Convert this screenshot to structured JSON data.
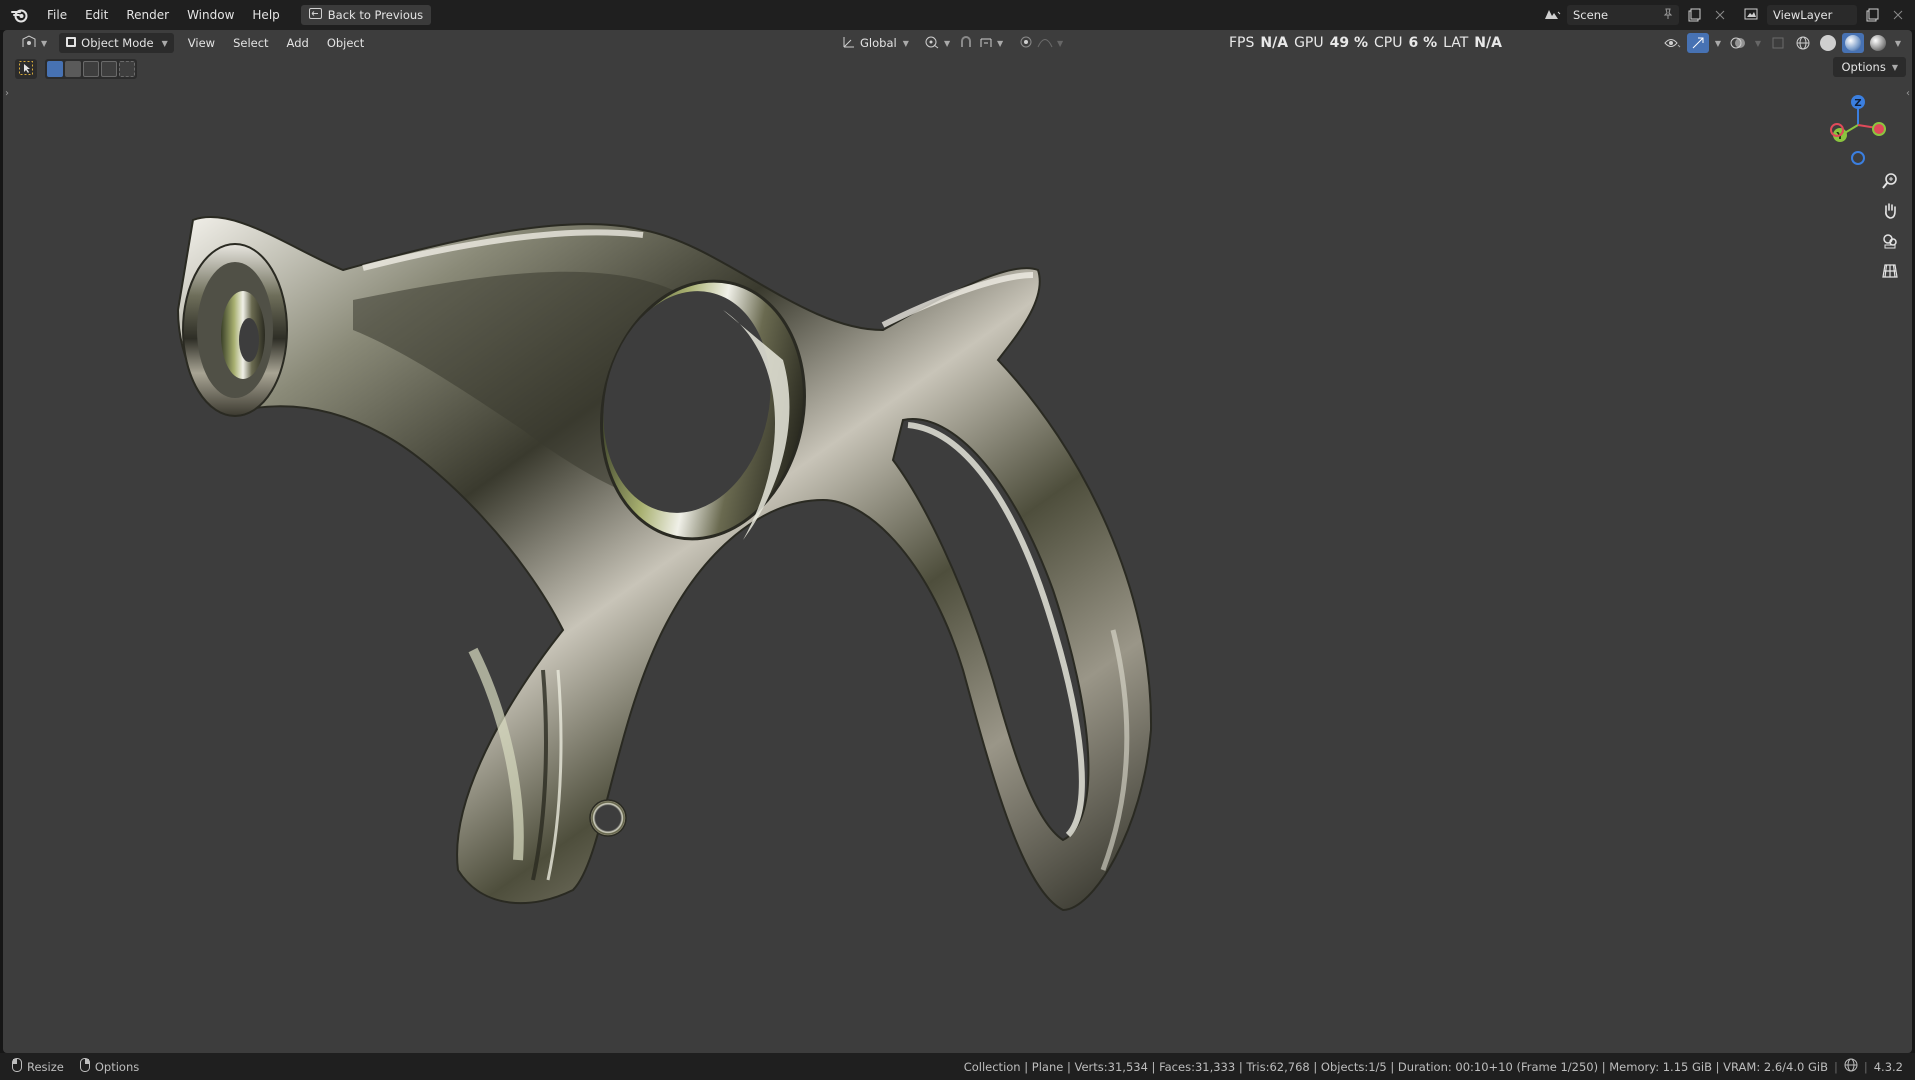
{
  "menu": {
    "items": [
      "File",
      "Edit",
      "Render",
      "Window",
      "Help"
    ],
    "back_button": "Back to Previous"
  },
  "scene": {
    "name": "Scene"
  },
  "view_layer": {
    "name": "ViewLayer"
  },
  "viewport_header": {
    "mode": "Object Mode",
    "menus": [
      "View",
      "Select",
      "Add",
      "Object"
    ],
    "orientation": "Global",
    "options": "Options"
  },
  "hud": {
    "fps_label": "FPS",
    "fps_value": "N/A",
    "gpu_label": "GPU",
    "gpu_value": "49 %",
    "cpu_label": "CPU",
    "cpu_value": "6 %",
    "lat_label": "LAT",
    "lat_value": "N/A"
  },
  "gizmo": {
    "z": "Z",
    "y": "Y"
  },
  "status": {
    "left": [
      "Resize",
      "Options"
    ],
    "stats": "Collection | Plane | Verts:31,534 | Faces:31,333 | Tris:62,768 | Objects:1/5 | Duration: 00:10+10 (Frame 1/250) | Memory: 1.15 GiB | VRAM: 2.6/4.0 GiB",
    "version": "4.3.2"
  },
  "colors": {
    "accent": "#4772b3",
    "axis_x": "#e04a5a",
    "axis_y": "#8bc53f",
    "axis_z": "#3b7fe0",
    "viewport_bg": "#3d3d3d"
  },
  "icons": [
    "blender-logo",
    "back-icon",
    "scene-icon",
    "pin-icon",
    "view-layer-icon",
    "editor-type-icon",
    "object-mode-icon",
    "transform-orientation-icon",
    "pivot-icon",
    "snap-icon",
    "proportional-icon",
    "select-box-icon",
    "zoom-icon",
    "pan-hand-icon",
    "camera-icon",
    "grid-icon",
    "globe-icon"
  ]
}
